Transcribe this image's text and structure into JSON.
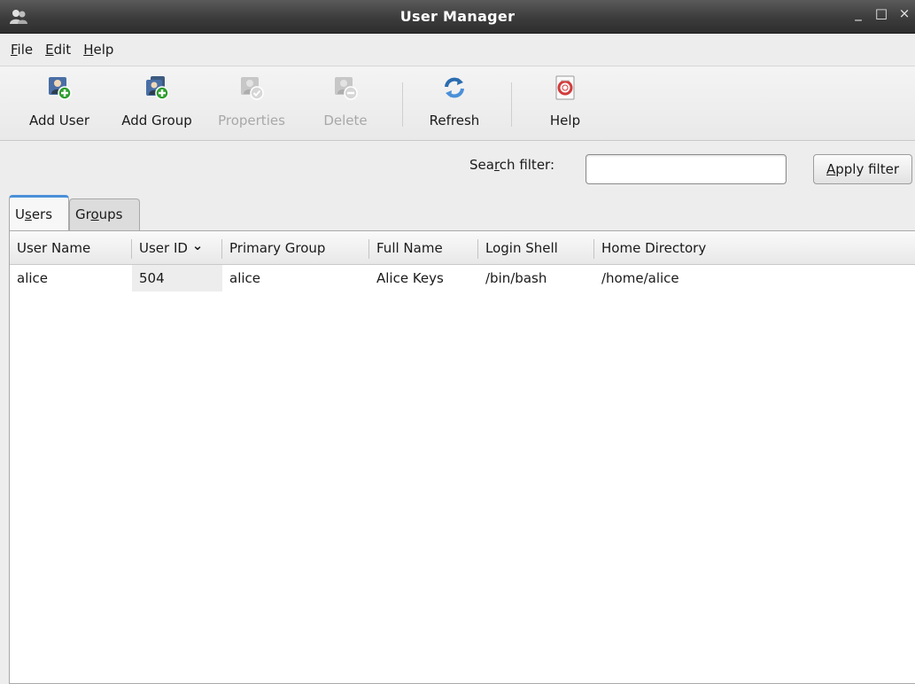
{
  "window": {
    "title": "User Manager",
    "controls": {
      "minimize": "_",
      "maximize": "□",
      "close": "×"
    }
  },
  "menubar": {
    "items": [
      {
        "label": "File",
        "mnemonic": "F",
        "rest": "ile"
      },
      {
        "label": "Edit",
        "mnemonic": "E",
        "rest": "dit"
      },
      {
        "label": "Help",
        "mnemonic": "H",
        "rest": "elp"
      }
    ]
  },
  "toolbar": {
    "add_user": "Add User",
    "add_group": "Add Group",
    "properties": "Properties",
    "delete": "Delete",
    "refresh": "Refresh",
    "help": "Help"
  },
  "filter": {
    "label_pre": "Sea",
    "label_mnemonic": "r",
    "label_post": "ch filter:",
    "value": "",
    "apply_mnemonic": "A",
    "apply_rest": "pply filter"
  },
  "tabs": {
    "users": {
      "pre": "U",
      "mnemonic": "s",
      "post": "ers"
    },
    "groups": {
      "pre": "Gr",
      "mnemonic": "o",
      "post": "ups"
    }
  },
  "table": {
    "columns": [
      "User Name",
      "User ID",
      "Primary Group",
      "Full Name",
      "Login Shell",
      "Home Directory"
    ],
    "sort_indicator": "⌄",
    "rows": [
      {
        "user_name": "alice",
        "user_id": "504",
        "primary_group": "alice",
        "full_name": "Alice Keys",
        "login_shell": "/bin/bash",
        "home_directory": "/home/alice"
      }
    ]
  },
  "colors": {
    "accent": "#4a90d9",
    "add_green": "#2e9e2e",
    "disabled_text": "#a8a8a8"
  }
}
